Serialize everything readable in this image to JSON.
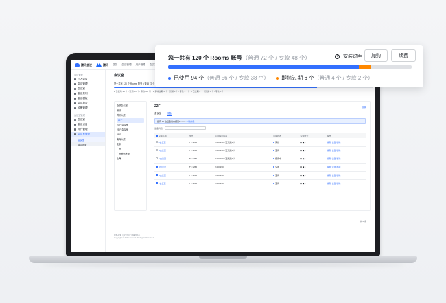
{
  "app": {
    "brand": "腾讯会议",
    "partner": "腾讯",
    "nav": [
      "总览",
      "会议管理",
      "用户管理",
      "会议室",
      "系统设置"
    ]
  },
  "sidebar": {
    "section_1": "会议管理",
    "items": [
      "个人会议",
      "会议管理",
      "会议室",
      "会议录制",
      "会议模板",
      "会议报告",
      "设备管理"
    ],
    "section_2": "会议室管理",
    "items2": [
      "会议室",
      "会议设备",
      "用户管理",
      "会议室管理"
    ],
    "sub_items": [
      "会议室",
      "楼层设置"
    ]
  },
  "main": {
    "title": "会议室",
    "mini_summary": "您一共有 120 个 Rooms 账号（普通 72 个 / 专款 48 个）",
    "mini_legend": "● 已使用 94 个（普通 56 个 / 专款 38 个）   ● 即将过期 6 个（普通 4 个 / 专款 2 个）   ● 已过期 0 个（普通 0 个 / 专款 0 个）",
    "mini_actions": [
      "安装说明",
      "加购",
      "续费"
    ],
    "tree": [
      "全部会议室",
      "深圳",
      "腾讯大厦",
      "22 F",
      "23 F 会议室",
      "25 F 会议室",
      "26 F",
      "南海大厦",
      "北京",
      "广州",
      "广州腾讯大厦",
      "上海"
    ],
    "panel": {
      "title": "22F",
      "more": "设置",
      "tabs": [
        "会议室",
        "设备"
      ],
      "notice": "您有 91 台设备尚未绑定Rooms",
      "notice_link": "一键升级",
      "toolbar_label": "设备列表",
      "columns": [
        "设备名称",
        "型号",
        "应用程序版本",
        "设备状态",
        "设备能力",
        "操作"
      ],
      "rows": [
        [
          "A会议室",
          "TT-7260",
          "2.0.0.190（正式版本）",
          "离线",
          "编辑 设置 移除"
        ],
        [
          "B会议室",
          "TT-7260",
          "2.0.0.190（正式版本）",
          "空闲",
          "编辑 设置 移除"
        ],
        [
          "C会议室",
          "TT-7260",
          "2.0.0.190（正式版本）",
          "使用中",
          "编辑 设置 移除"
        ],
        [
          "D会议室",
          "TT-7260",
          "2.0.0.190",
          "空闲",
          "编辑 设置 移除"
        ],
        [
          "E会议室",
          "TT-7260",
          "2.0.0.190",
          "空闲",
          "编辑 设置 移除"
        ],
        [
          "F会议室",
          "TT-7260",
          "2.0.0.190",
          "空闲",
          "编辑 设置 移除"
        ]
      ]
    },
    "pager": "共 6 条",
    "footer_1": "隐私政策 | 服务协议 | 帮助中心",
    "footer_2": "Copyright © 2021 Tencent. All Rights Reserved."
  },
  "card": {
    "title": "您一共有 120 个 Rooms 账号",
    "title_detail": "（普通 72 个 / 专款 48 个）",
    "help": "安装说明",
    "buy": "加购",
    "renew": "续费",
    "used_fraction": 0.783,
    "expiring_fraction": 0.05,
    "used_label": "已使用 94 个",
    "used_detail": "（普通 56 个 / 专款 38 个）",
    "expiring_label": "即将过期 6 个",
    "expiring_detail": "（普通 4 个 / 专款 2 个）",
    "colors": {
      "used": "#3370ff",
      "expiring": "#ff8800",
      "track": "#dfe1e5"
    }
  }
}
